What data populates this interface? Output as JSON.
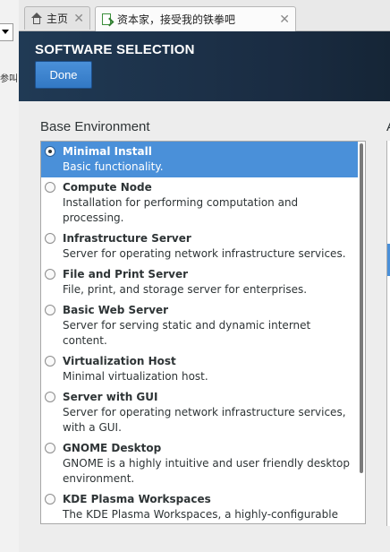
{
  "browser": {
    "left_clip_text": "参叫",
    "tabs": [
      {
        "label": "主页",
        "icon": "home-icon"
      },
      {
        "label": "资本家，接受我的铁拳吧",
        "icon": "page-icon"
      }
    ],
    "close_glyph": "✕"
  },
  "installer": {
    "title": "SOFTWARE SELECTION",
    "done_label": "Done",
    "section_title": "Base Environment",
    "right_clip_title": "A",
    "environments": [
      {
        "name": "Minimal Install",
        "desc": "Basic functionality.",
        "selected": true
      },
      {
        "name": "Compute Node",
        "desc": "Installation for performing computation and processing.",
        "selected": false
      },
      {
        "name": "Infrastructure Server",
        "desc": "Server for operating network infrastructure services.",
        "selected": false
      },
      {
        "name": "File and Print Server",
        "desc": "File, print, and storage server for enterprises.",
        "selected": false
      },
      {
        "name": "Basic Web Server",
        "desc": "Server for serving static and dynamic internet content.",
        "selected": false
      },
      {
        "name": "Virtualization Host",
        "desc": "Minimal virtualization host.",
        "selected": false
      },
      {
        "name": "Server with GUI",
        "desc": "Server for operating network infrastructure services, with a GUI.",
        "selected": false
      },
      {
        "name": "GNOME Desktop",
        "desc": "GNOME is a highly intuitive and user friendly desktop environment.",
        "selected": false
      },
      {
        "name": "KDE Plasma Workspaces",
        "desc": "The KDE Plasma Workspaces, a highly-configurable graphical user interface which includes a panel, desktop, system icons and desktop widgets, and many powerful KDE applications.",
        "selected": false
      }
    ]
  },
  "colors": {
    "header_bg": "#1b2e44",
    "accent": "#4a90d9",
    "content_bg": "#ededed"
  }
}
